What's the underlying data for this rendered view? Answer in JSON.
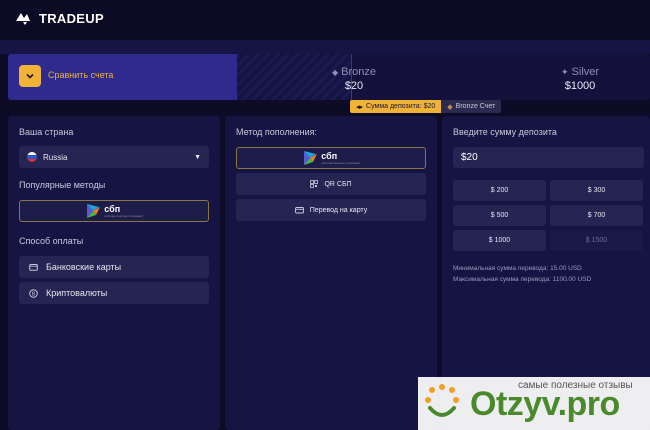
{
  "header": {
    "logo_text": "TRADEUP"
  },
  "tiers": {
    "compare_label": "Сравнить счета",
    "items": [
      {
        "name": "Bronze",
        "value": "$20"
      },
      {
        "name": "Silver",
        "value": "$1000"
      }
    ],
    "deposit_badge": "Сумма депозита: $20",
    "account_badge": "Bronze Счет"
  },
  "country_panel": {
    "country_label": "Ваша страна",
    "country_value": "Russia",
    "popular_label": "Популярные методы",
    "payment_label": "Способ оплаты",
    "payment_options": [
      "Банковские карты",
      "Криптовалюты"
    ]
  },
  "method_panel": {
    "title": "Метод пополнения:",
    "qr_label": "QR СБП",
    "card_transfer_label": "Перевод на карту"
  },
  "sbp": {
    "word": "сбп",
    "subtitle": "система быстрых платежей"
  },
  "amount_panel": {
    "title": "Введите сумму депозита",
    "input_value": "$20",
    "presets": [
      "$ 200",
      "$ 300",
      "$ 500",
      "$ 700",
      "$ 1000",
      "$ 1500"
    ],
    "min_note": "Минимальная сумма перевода: 15.00 USD",
    "max_note": "Максимальная сумма перевода: 1100.00 USD"
  },
  "watermark": {
    "tagline": "самые полезные отзывы",
    "brand": "Otzyv.pro"
  },
  "colors": {
    "accent": "#f0b338",
    "background": "#0d0b26",
    "panel": "#161443",
    "watermark_green": "#4a8a2c"
  }
}
